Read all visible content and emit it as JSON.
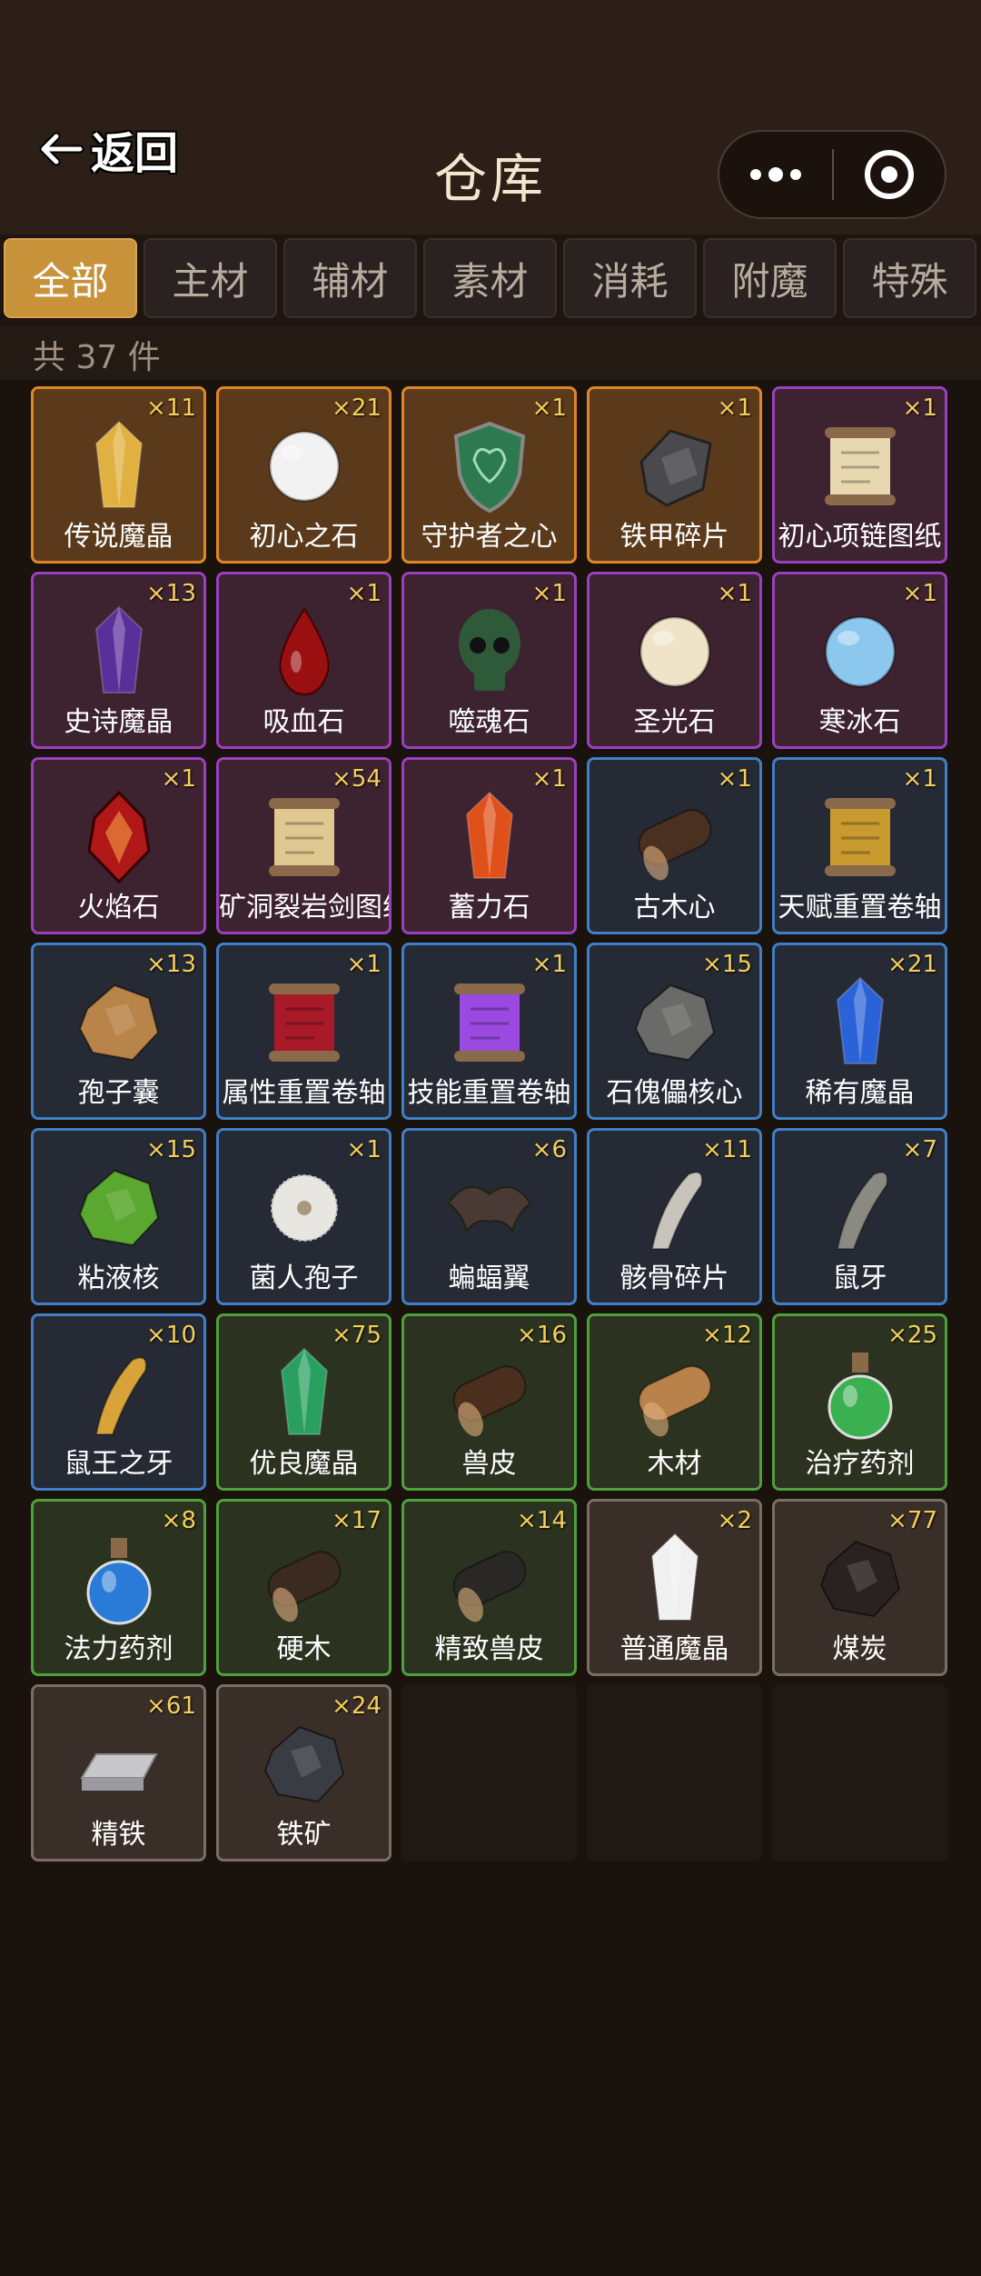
{
  "header": {
    "back_label": "返回",
    "title": "仓库"
  },
  "tabs": [
    {
      "label": "全部",
      "active": true
    },
    {
      "label": "主材",
      "active": false
    },
    {
      "label": "辅材",
      "active": false
    },
    {
      "label": "素材",
      "active": false
    },
    {
      "label": "消耗",
      "active": false
    },
    {
      "label": "附魔",
      "active": false
    },
    {
      "label": "特殊",
      "active": false
    }
  ],
  "count_text": "共 37 件",
  "items": [
    {
      "name": "传说魔晶",
      "qty": "×11",
      "rarity": "orange",
      "icon": "gold-crystal-icon",
      "color": "#e0b040"
    },
    {
      "name": "初心之石",
      "qty": "×21",
      "rarity": "orange",
      "icon": "white-stone-icon",
      "color": "#f2f2f2"
    },
    {
      "name": "守护者之心",
      "qty": "×1",
      "rarity": "orange",
      "icon": "green-shield-icon",
      "color": "#2e7a50"
    },
    {
      "name": "铁甲碎片",
      "qty": "×1",
      "rarity": "orange",
      "icon": "iron-armor-icon",
      "color": "#4a4a4e"
    },
    {
      "name": "初心项链图纸",
      "qty": "×1",
      "rarity": "purple",
      "icon": "necklace-scroll-icon",
      "color": "#e8d8b0"
    },
    {
      "name": "史诗魔晶",
      "qty": "×13",
      "rarity": "purple",
      "icon": "purple-crystal-icon",
      "color": "#5a2f9a"
    },
    {
      "name": "吸血石",
      "qty": "×1",
      "rarity": "purple",
      "icon": "blood-drop-icon",
      "color": "#9a1010"
    },
    {
      "name": "噬魂石",
      "qty": "×1",
      "rarity": "purple",
      "icon": "skull-icon",
      "color": "#2f5a3a"
    },
    {
      "name": "圣光石",
      "qty": "×1",
      "rarity": "purple",
      "icon": "holy-stone-icon",
      "color": "#f0e4c8"
    },
    {
      "name": "寒冰石",
      "qty": "×1",
      "rarity": "purple",
      "icon": "ice-stone-icon",
      "color": "#8cc8ee"
    },
    {
      "name": "火焰石",
      "qty": "×1",
      "rarity": "purple",
      "icon": "fire-gem-icon",
      "color": "#b01818"
    },
    {
      "name": "矿洞裂岩剑图纸",
      "qty": "×54",
      "rarity": "purple",
      "icon": "sword-scroll-icon",
      "color": "#e0c890"
    },
    {
      "name": "蓄力石",
      "qty": "×1",
      "rarity": "purple",
      "icon": "flame-crystal-icon",
      "color": "#e0501a"
    },
    {
      "name": "古木心",
      "qty": "×1",
      "rarity": "blue",
      "icon": "wood-heart-icon",
      "color": "#4a3020"
    },
    {
      "name": "天赋重置卷轴",
      "qty": "×1",
      "rarity": "blue",
      "icon": "golden-scroll-icon",
      "color": "#c89a30"
    },
    {
      "name": "孢子囊",
      "qty": "×13",
      "rarity": "blue",
      "icon": "spore-sac-icon",
      "color": "#b8844a"
    },
    {
      "name": "属性重置卷轴",
      "qty": "×1",
      "rarity": "blue",
      "icon": "red-scroll-icon",
      "color": "#a81a28"
    },
    {
      "name": "技能重置卷轴",
      "qty": "×1",
      "rarity": "blue",
      "icon": "purple-scroll-icon",
      "color": "#9a4ae0"
    },
    {
      "name": "石傀儡核心",
      "qty": "×15",
      "rarity": "blue",
      "icon": "stone-core-icon",
      "color": "#6a6a68"
    },
    {
      "name": "稀有魔晶",
      "qty": "×21",
      "rarity": "blue",
      "icon": "blue-crystal-icon",
      "color": "#2a62d8"
    },
    {
      "name": "粘液核",
      "qty": "×15",
      "rarity": "blue",
      "icon": "slime-core-icon",
      "color": "#5aa830"
    },
    {
      "name": "菌人孢子",
      "qty": "×1",
      "rarity": "blue",
      "icon": "dandelion-icon",
      "color": "#e8e6e0"
    },
    {
      "name": "蝙蝠翼",
      "qty": "×6",
      "rarity": "blue",
      "icon": "bat-wing-icon",
      "color": "#4a3a36"
    },
    {
      "name": "骸骨碎片",
      "qty": "×11",
      "rarity": "blue",
      "icon": "bone-fragment-icon",
      "color": "#c8c4bc"
    },
    {
      "name": "鼠牙",
      "qty": "×7",
      "rarity": "blue",
      "icon": "rat-tooth-icon",
      "color": "#8a8a82"
    },
    {
      "name": "鼠王之牙",
      "qty": "×10",
      "rarity": "blue",
      "icon": "golden-fang-icon",
      "color": "#d8a43a"
    },
    {
      "name": "优良魔晶",
      "qty": "×75",
      "rarity": "green",
      "icon": "green-crystal-icon",
      "color": "#2aa060"
    },
    {
      "name": "兽皮",
      "qty": "×16",
      "rarity": "green",
      "icon": "hide-roll-icon",
      "color": "#4a2e1e"
    },
    {
      "name": "木材",
      "qty": "×12",
      "rarity": "green",
      "icon": "log-icon",
      "color": "#b8824a"
    },
    {
      "name": "治疗药剂",
      "qty": "×25",
      "rarity": "green",
      "icon": "green-potion-icon",
      "color": "#3ab050"
    },
    {
      "name": "法力药剂",
      "qty": "×8",
      "rarity": "green",
      "icon": "blue-potion-icon",
      "color": "#2a7ad8"
    },
    {
      "name": "硬木",
      "qty": "×17",
      "rarity": "green",
      "icon": "hardwood-icon",
      "color": "#3a2a20"
    },
    {
      "name": "精致兽皮",
      "qty": "×14",
      "rarity": "green",
      "icon": "fine-hide-icon",
      "color": "#2a2826"
    },
    {
      "name": "普通魔晶",
      "qty": "×2",
      "rarity": "gray",
      "icon": "quartz-icon",
      "color": "#f0f0f0"
    },
    {
      "name": "煤炭",
      "qty": "×77",
      "rarity": "gray",
      "icon": "coal-icon",
      "color": "#2a2220"
    },
    {
      "name": "精铁",
      "qty": "×61",
      "rarity": "gray",
      "icon": "iron-ingot-icon",
      "color": "#c8c8cc"
    },
    {
      "name": "铁矿",
      "qty": "×24",
      "rarity": "gray",
      "icon": "iron-ore-icon",
      "color": "#3a3c44"
    }
  ],
  "empty_slots": 3
}
